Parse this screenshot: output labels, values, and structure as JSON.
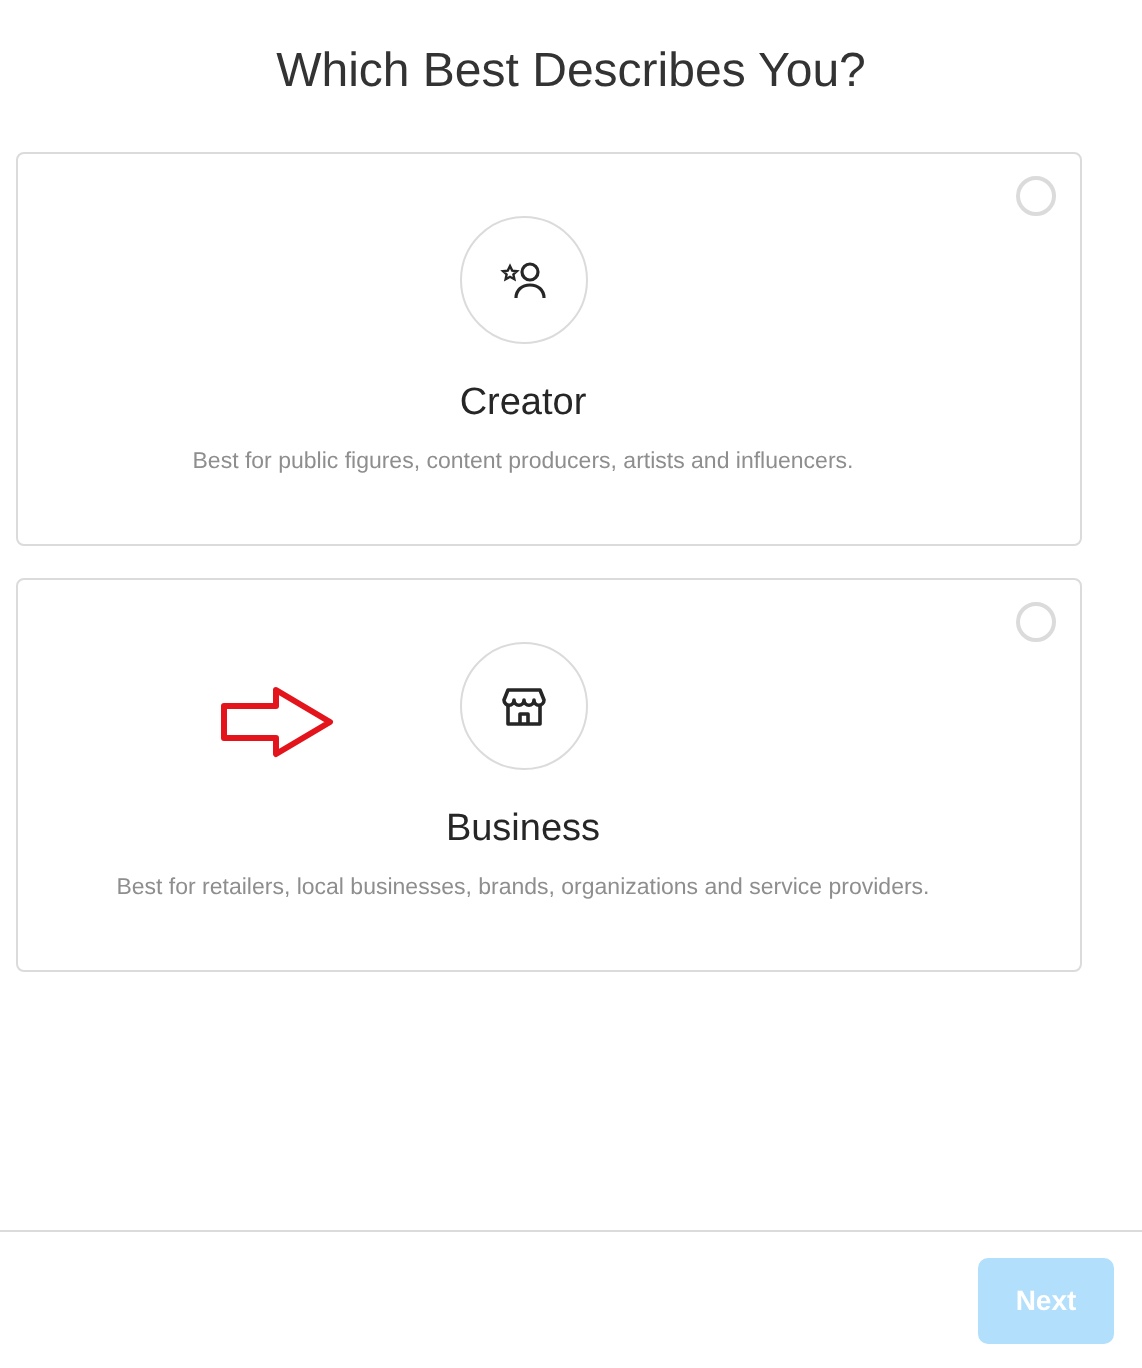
{
  "title": "Which Best Describes You?",
  "options": [
    {
      "kind": "creator",
      "label": "Creator",
      "description": "Best for public figures, content producers, artists and influencers.",
      "selected": false,
      "marked": false
    },
    {
      "kind": "business",
      "label": "Business",
      "description": "Best for retailers, local businesses, brands, organizations and service providers.",
      "selected": false,
      "marked": true
    }
  ],
  "next_button": {
    "label": "Next",
    "disabled": true
  }
}
